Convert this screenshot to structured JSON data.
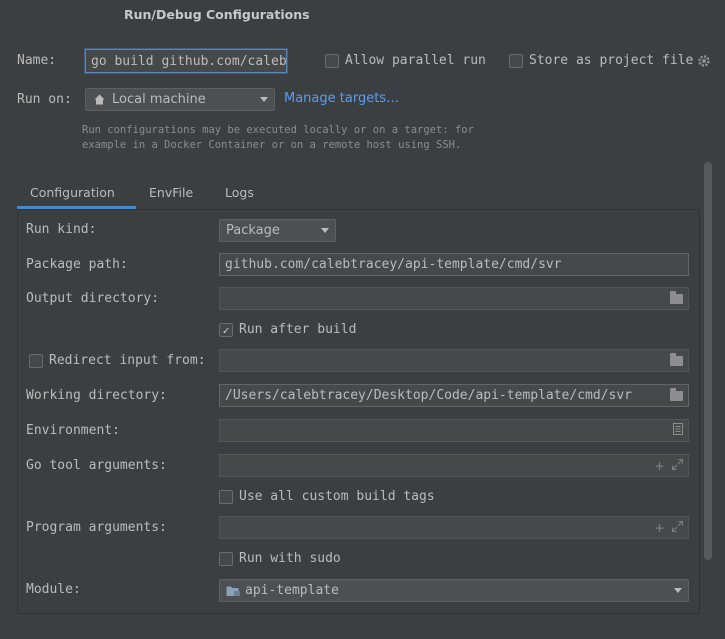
{
  "window": {
    "title": "Run/Debug Configurations"
  },
  "name": {
    "label": "Name:",
    "value": "go build github.com/calebtracey/api-template/cmd/svr",
    "allow_parallel_label": "Allow parallel run",
    "allow_parallel_checked": false,
    "store_project_label": "Store as project file",
    "store_project_checked": false
  },
  "run_on": {
    "label": "Run on:",
    "value": "Local machine",
    "manage_link": "Manage targets…",
    "hint_line1": "Run configurations may be executed locally or on a target: for",
    "hint_line2": "example in a Docker Container or on a remote host using SSH."
  },
  "tabs": [
    {
      "label": "Configuration",
      "active": true
    },
    {
      "label": "EnvFile",
      "active": false
    },
    {
      "label": "Logs",
      "active": false
    }
  ],
  "config": {
    "run_kind_label": "Run kind:",
    "run_kind_value": "Package",
    "package_path_label": "Package path:",
    "package_path_value": "github.com/calebtracey/api-template/cmd/svr",
    "output_dir_label": "Output directory:",
    "output_dir_value": "",
    "run_after_build_label": "Run after build",
    "run_after_build_checked": true,
    "redirect_input_label": "Redirect input from:",
    "redirect_input_checked": false,
    "redirect_input_value": "",
    "working_dir_label": "Working directory:",
    "working_dir_value": "/Users/calebtracey/Desktop/Code/api-template/cmd/svr",
    "environment_label": "Environment:",
    "environment_value": "",
    "go_tool_args_label": "Go tool arguments:",
    "go_tool_args_value": "",
    "custom_tags_label": "Use all custom build tags",
    "custom_tags_checked": false,
    "program_args_label": "Program arguments:",
    "program_args_value": "",
    "run_sudo_label": "Run with sudo",
    "run_sudo_checked": false,
    "module_label": "Module:",
    "module_value": "api-template"
  },
  "colors": {
    "background": "#3c3f41",
    "link": "#589df6",
    "tab_underline": "#4a88c7",
    "text": "#bbbbbb"
  }
}
